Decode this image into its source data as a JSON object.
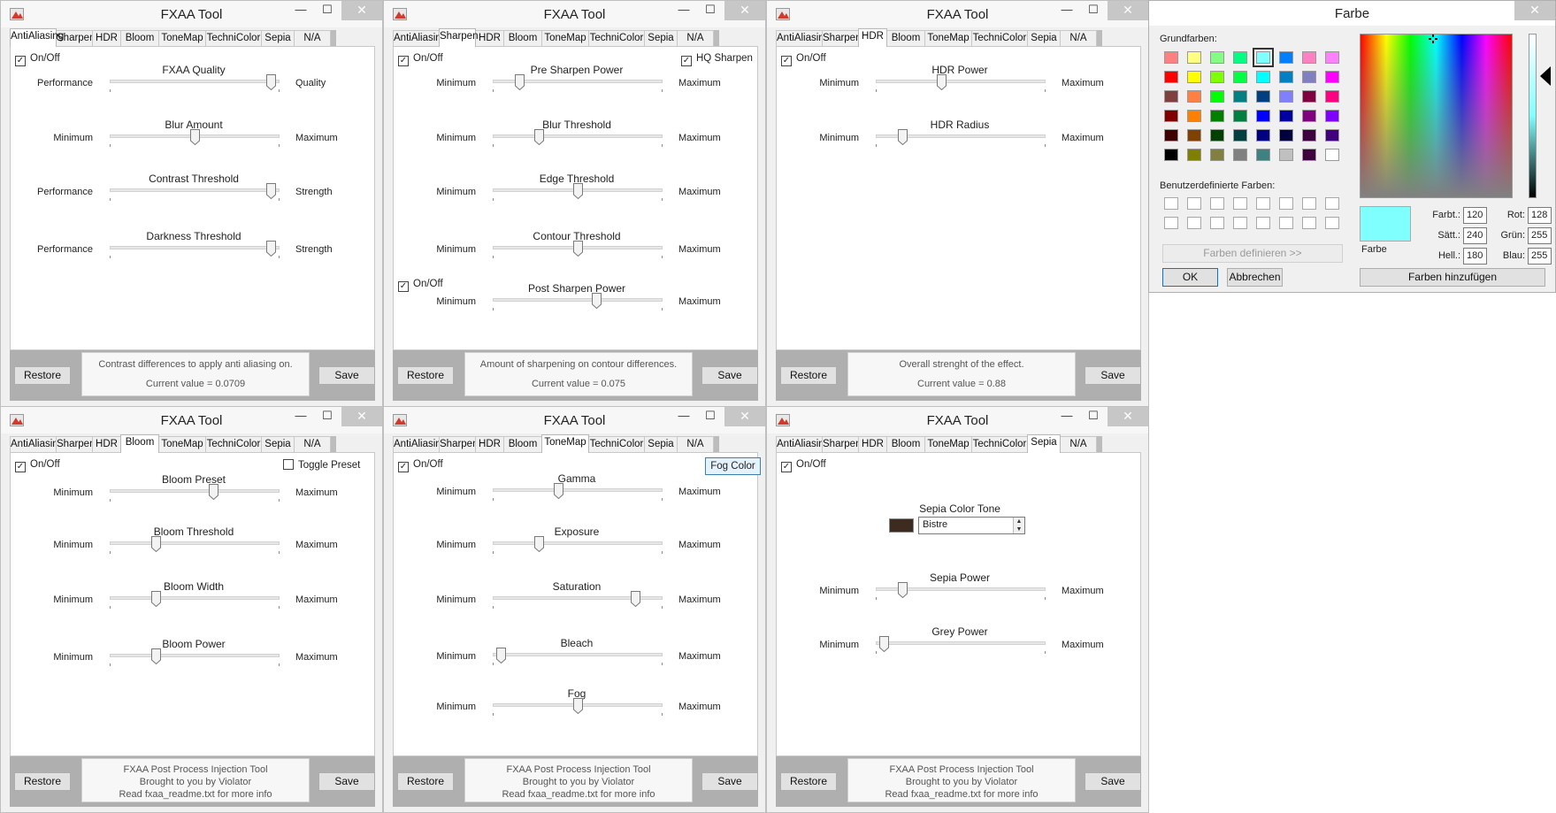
{
  "app_title": "FXAA Tool",
  "tabs": [
    "AntiAliasing",
    "Sharpen",
    "HDR",
    "Bloom",
    "ToneMap",
    "TechniColor",
    "Sepia",
    "N/A"
  ],
  "restore_label": "Restore",
  "save_label": "Save",
  "footer_info_default": {
    "line1": "FXAA Post Process Injection Tool",
    "line2": "Brought to you by Violator",
    "line3": "Read fxaa_readme.txt for more info"
  },
  "windows": {
    "antialiasing": {
      "onoff": "On/Off",
      "sliders": [
        {
          "title": "FXAA Quality",
          "min": "Performance",
          "max": "Quality",
          "value": 0.98
        },
        {
          "title": "Blur Amount",
          "min": "Minimum",
          "max": "Maximum",
          "value": 0.5
        },
        {
          "title": "Contrast Threshold",
          "min": "Performance",
          "max": "Strength",
          "value": 0.98
        },
        {
          "title": "Darkness Threshold",
          "min": "Performance",
          "max": "Strength",
          "value": 0.98
        }
      ],
      "info": {
        "line1": "Contrast differences to apply anti aliasing on.",
        "line2": "Current value = 0.0709"
      }
    },
    "sharpen": {
      "onoff": "On/Off",
      "hq": "HQ Sharpen",
      "post_onoff": "On/Off",
      "sliders": [
        {
          "title": "Pre Sharpen Power",
          "min": "Minimum",
          "max": "Maximum",
          "value": 0.14
        },
        {
          "title": "Blur Threshold",
          "min": "Minimum",
          "max": "Maximum",
          "value": 0.26
        },
        {
          "title": "Edge Threshold",
          "min": "Minimum",
          "max": "Maximum",
          "value": 0.5
        },
        {
          "title": "Contour Threshold",
          "min": "Minimum",
          "max": "Maximum",
          "value": 0.5
        },
        {
          "title": "Post Sharpen Power",
          "min": "Minimum",
          "max": "Maximum",
          "value": 0.62
        }
      ],
      "info": {
        "line1": "Amount of sharpening on contour differences.",
        "line2": "Current value = 0.075"
      }
    },
    "hdr": {
      "onoff": "On/Off",
      "sliders": [
        {
          "title": "HDR Power",
          "min": "Minimum",
          "max": "Maximum",
          "value": 0.38
        },
        {
          "title": "HDR Radius",
          "min": "Minimum",
          "max": "Maximum",
          "value": 0.14
        }
      ],
      "info": {
        "line1": "Overall strenght of the effect.",
        "line2": "Current value = 0.88"
      }
    },
    "bloom": {
      "onoff": "On/Off",
      "toggle": "Toggle Preset",
      "sliders": [
        {
          "title": "Bloom Preset",
          "min": "Minimum",
          "max": "Maximum",
          "value": 0.62
        },
        {
          "title": "Bloom Threshold",
          "min": "Minimum",
          "max": "Maximum",
          "value": 0.26
        },
        {
          "title": "Bloom Width",
          "min": "Minimum",
          "max": "Maximum",
          "value": 0.26
        },
        {
          "title": "Bloom Power",
          "min": "Minimum",
          "max": "Maximum",
          "value": 0.26
        }
      ]
    },
    "tonemap": {
      "onoff": "On/Off",
      "fog_button": "Fog Color",
      "sliders": [
        {
          "title": "Gamma",
          "min": "Minimum",
          "max": "Maximum",
          "value": 0.38
        },
        {
          "title": "Exposure",
          "min": "Minimum",
          "max": "Maximum",
          "value": 0.26
        },
        {
          "title": "Saturation",
          "min": "Minimum",
          "max": "Maximum",
          "value": 0.86
        },
        {
          "title": "Bleach",
          "min": "Minimum",
          "max": "Maximum",
          "value": 0.02
        },
        {
          "title": "Fog",
          "min": "Minimum",
          "max": "Maximum",
          "value": 0.5
        }
      ]
    },
    "sepia": {
      "onoff": "On/Off",
      "tone_title": "Sepia Color Tone",
      "tone_value": "Bistre",
      "tone_color": "#3d2b1f",
      "sliders": [
        {
          "title": "Sepia Power",
          "min": "Minimum",
          "max": "Maximum",
          "value": 0.14
        },
        {
          "title": "Grey Power",
          "min": "Minimum",
          "max": "Maximum",
          "value": 0.02
        }
      ]
    }
  },
  "color_dialog": {
    "title": "Farbe",
    "basic_label": "Grundfarben:",
    "custom_label": "Benutzerdefinierte Farben:",
    "define_button": "Farben definieren >>",
    "ok": "OK",
    "cancel": "Abbrechen",
    "add_button": "Farben hinzufügen",
    "preview_label": "Farbe",
    "preview_color": "#80ffff",
    "fields": {
      "hue_label": "Farbt.:",
      "hue": "120",
      "sat_label": "Sätt.:",
      "sat": "240",
      "lum_label": "Hell.:",
      "lum": "180",
      "red_label": "Rot:",
      "red": "128",
      "green_label": "Grün:",
      "green": "255",
      "blue_label": "Blau:",
      "blue": "255"
    },
    "basic_colors": [
      "#ff8080",
      "#ffff80",
      "#80ff80",
      "#00ff80",
      "#80ffff",
      "#0080ff",
      "#ff80c0",
      "#ff80ff",
      "#ff0000",
      "#ffff00",
      "#80ff00",
      "#00ff40",
      "#00ffff",
      "#0080c0",
      "#8080c0",
      "#ff00ff",
      "#804040",
      "#ff8040",
      "#00ff00",
      "#008080",
      "#004080",
      "#8080ff",
      "#800040",
      "#ff0080",
      "#800000",
      "#ff8000",
      "#008000",
      "#008040",
      "#0000ff",
      "#0000a0",
      "#800080",
      "#8000ff",
      "#400000",
      "#804000",
      "#004000",
      "#004040",
      "#000080",
      "#000040",
      "#400040",
      "#400080",
      "#000000",
      "#808000",
      "#808040",
      "#808080",
      "#408080",
      "#c0c0c0",
      "#400040",
      "#ffffff"
    ],
    "selected_index": 4
  }
}
